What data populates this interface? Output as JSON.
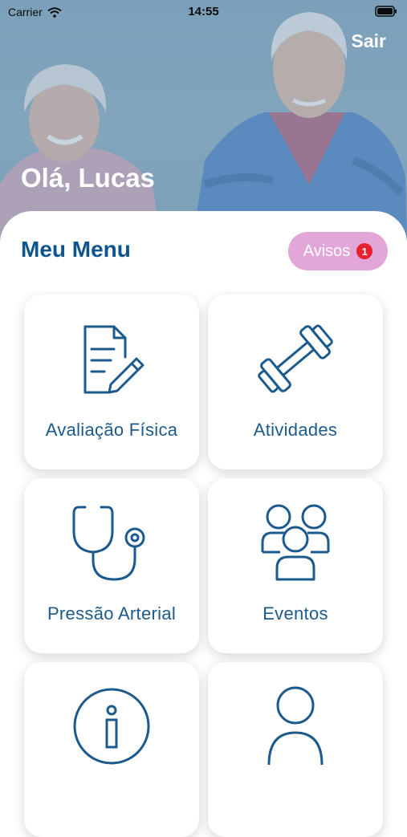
{
  "status_bar": {
    "carrier": "Carrier",
    "time": "14:55"
  },
  "header": {
    "logout_label": "Sair",
    "greeting": "Olá, Lucas"
  },
  "menu": {
    "title": "Meu Menu",
    "notices_label": "Avisos",
    "notices_count": "1",
    "items": [
      {
        "label": "Avaliação Física",
        "icon": "document-edit-icon"
      },
      {
        "label": "Atividades",
        "icon": "dumbbell-icon"
      },
      {
        "label": "Pressão Arterial",
        "icon": "stethoscope-icon"
      },
      {
        "label": "Eventos",
        "icon": "group-icon"
      },
      {
        "label": "",
        "icon": "info-circle-icon"
      },
      {
        "label": "",
        "icon": "user-icon"
      }
    ]
  },
  "colors": {
    "primary": "#0f548c",
    "card_text": "#1c5a8e",
    "notices_bg": "#e3a6d8",
    "badge": "#e8212e"
  }
}
